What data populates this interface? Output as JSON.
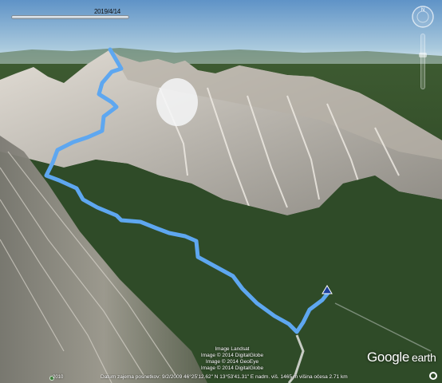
{
  "time_slider": {
    "label": "2019/4/14"
  },
  "attribution": {
    "lines": [
      "Image Landsat",
      "Image © 2014 DigitalGlobe",
      "Image © 2014 GeoEye",
      "Image © 2014 DigitalGlobe"
    ]
  },
  "status_bar": {
    "year": "2010",
    "text": "Datum zajema posnetkov: 9/2/2009   46°25'12.62\" N  13°53'41.31\" E  nadm. viš. 1465 m   višina očesa 2.71 km"
  },
  "logo": {
    "google": "Google",
    "earth": "earth"
  },
  "icons": {
    "north": "compass-icon",
    "zoom": "zoom-slider",
    "street": "street-view-icon",
    "marker": "track-end-marker"
  },
  "colors": {
    "track": "#5ea7f0",
    "sky_top": "#5f93c7",
    "sky_bottom": "#cfe1ea",
    "forest": "#27421f",
    "rock": "#cfcac2"
  }
}
